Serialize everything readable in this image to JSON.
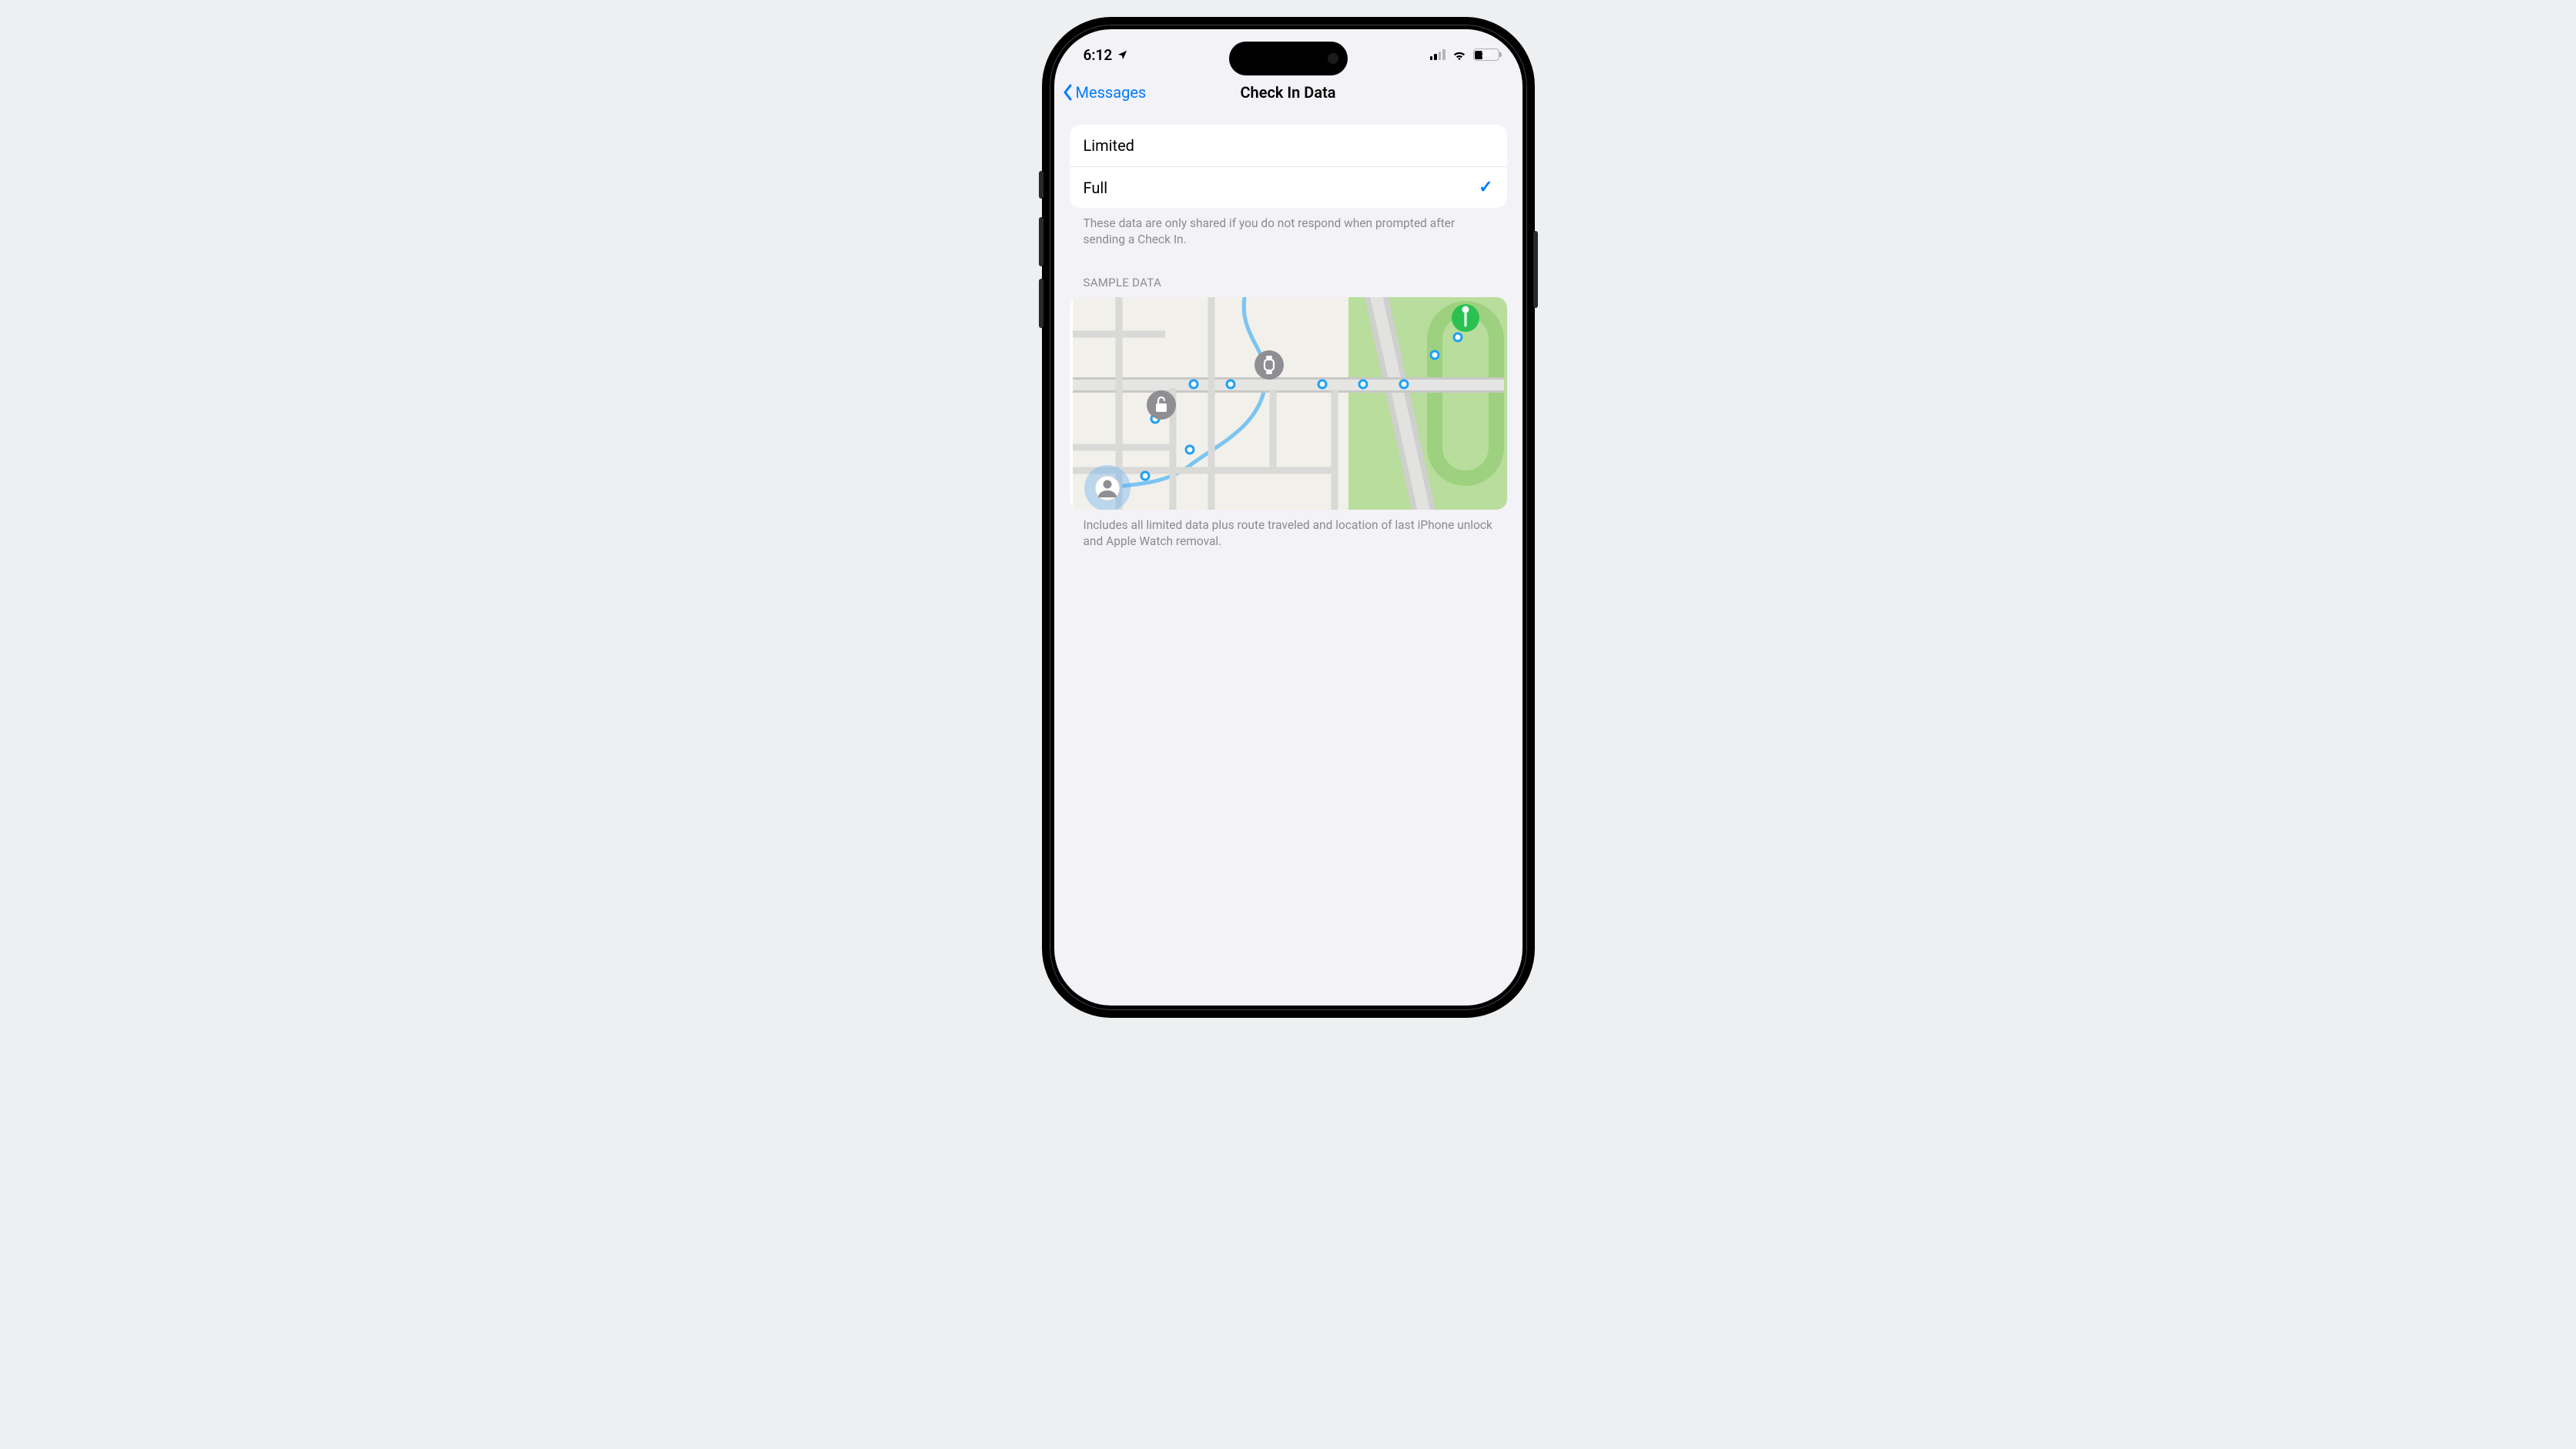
{
  "status": {
    "time": "6:12",
    "locationServicesActive": true,
    "cellularBars": 2,
    "cellularTotalBars": 4,
    "wifi": true,
    "batteryPercent": "30"
  },
  "nav": {
    "backLabel": "Messages",
    "title": "Check In Data"
  },
  "dataOptions": {
    "items": [
      {
        "label": "Limited",
        "selected": false
      },
      {
        "label": "Full",
        "selected": true
      }
    ],
    "footer": "These data are only shared if you do not respond when prompted after sending a Check In."
  },
  "sample": {
    "header": "SAMPLE DATA",
    "footer": "Includes all limited data plus route traveled and location of last iPhone unlock and Apple Watch removal."
  },
  "colors": {
    "accent": "#007aff",
    "background": "#f2f2f7",
    "cardBg": "#ffffff",
    "footerText": "#8a8a8f",
    "mapGreen": "#b7e09c",
    "mapDestination": "#2ac151"
  }
}
